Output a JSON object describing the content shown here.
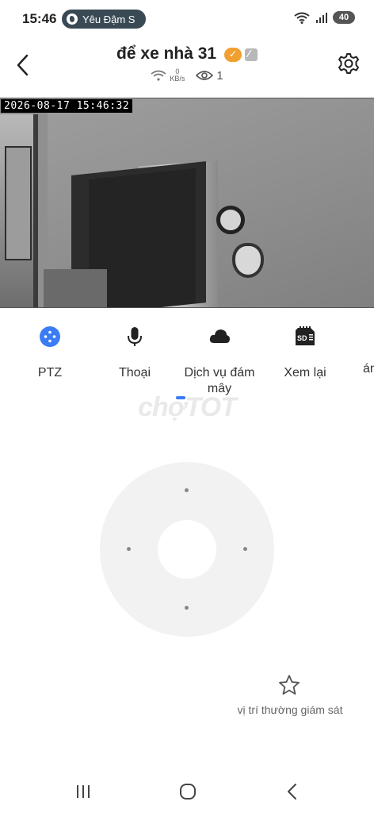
{
  "status_bar": {
    "time": "15:46",
    "notification": "Yêu Đậm S",
    "battery": "40"
  },
  "header": {
    "title": "để xe nhà 31",
    "speed_value": "0",
    "speed_unit": "KB/s",
    "viewers": "1"
  },
  "video": {
    "timestamp": "2026-08-17  15:46:32"
  },
  "actions": [
    {
      "label": "PTZ",
      "icon": "ptz-icon",
      "active": true
    },
    {
      "label": "Thoại",
      "icon": "microphone-icon"
    },
    {
      "label": "Dịch vụ đám mây",
      "icon": "cloud-icon"
    },
    {
      "label": "Xem lại",
      "icon": "sd-card-icon"
    },
    {
      "label": "án"
    }
  ],
  "watermark": "chợTOT",
  "favorite": {
    "label": "vị trí thường giám sát",
    "icon": "star-icon"
  },
  "colors": {
    "accent": "#3b7cf5",
    "badge": "#f0a030",
    "joystick": "#f2f2f2"
  }
}
